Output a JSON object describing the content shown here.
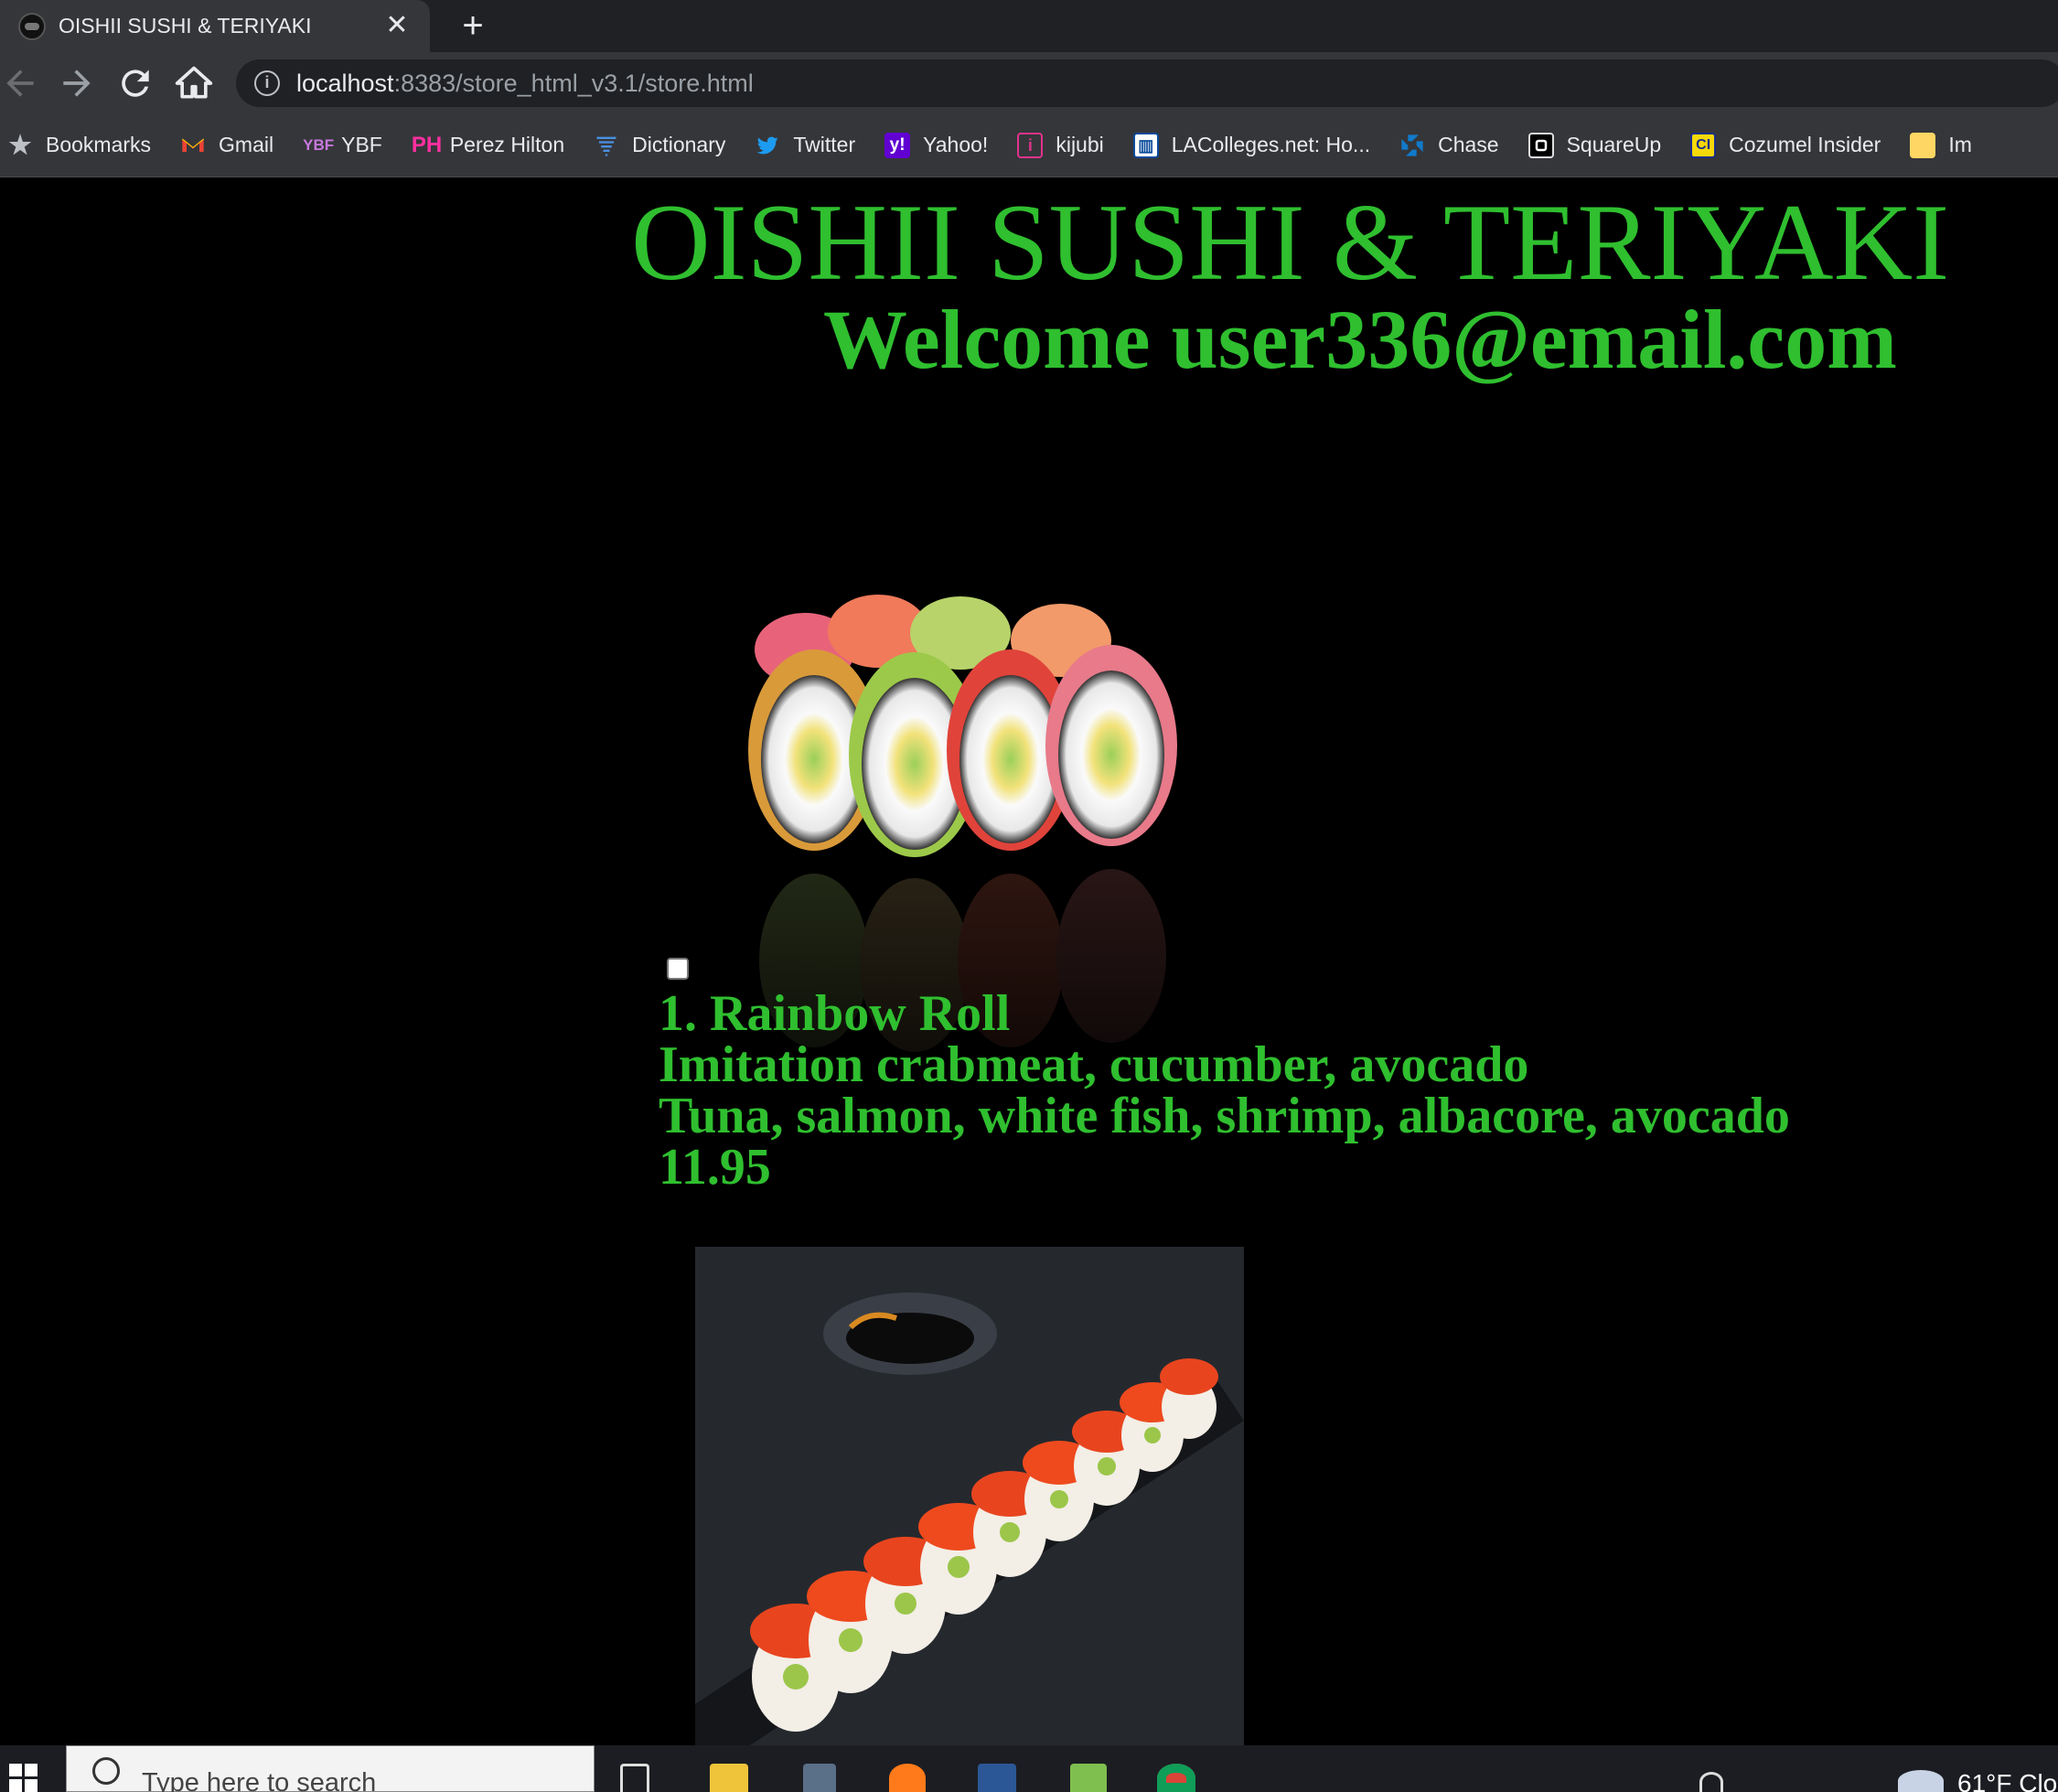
{
  "browser": {
    "tab_title": "OISHII SUSHI & TERIYAKI",
    "tab_close": "✕",
    "new_tab": "+",
    "url_host": "localhost",
    "url_path": ":8383/store_html_v3.1/store.html"
  },
  "bookmarks": [
    {
      "label": "Bookmarks",
      "icon": "star-icon"
    },
    {
      "label": "Gmail",
      "icon": "gmail-icon"
    },
    {
      "label": "YBF",
      "icon": "ybf-icon"
    },
    {
      "label": "Perez Hilton",
      "icon": "perez-hilton-icon"
    },
    {
      "label": "Dictionary",
      "icon": "dictionary-icon"
    },
    {
      "label": "Twitter",
      "icon": "twitter-icon"
    },
    {
      "label": "Yahoo!",
      "icon": "yahoo-icon"
    },
    {
      "label": "kijubi",
      "icon": "kijubi-icon"
    },
    {
      "label": "LAColleges.net: Ho...",
      "icon": "lacolleges-icon"
    },
    {
      "label": "Chase",
      "icon": "chase-icon"
    },
    {
      "label": "SquareUp",
      "icon": "squareup-icon"
    },
    {
      "label": "Cozumel Insider",
      "icon": "cozumel-icon"
    },
    {
      "label": "Im",
      "icon": "folder-icon"
    }
  ],
  "page": {
    "title": "OISHII SUSHI & TERIYAKI",
    "welcome": "Welcome user336@email.com",
    "items": [
      {
        "name": "1. Rainbow Roll",
        "inside": "Imitation crabmeat, cucumber, avocado",
        "topping": "Tuna, salmon, white fish, shrimp, albacore, avocado",
        "price": "11.95",
        "checked": false
      }
    ]
  },
  "taskbar": {
    "search_placeholder": "Type here to search",
    "weather": "61°F  Clo"
  },
  "colors": {
    "accent_green": "#2fbf2f",
    "page_bg": "#000000",
    "chrome_bg": "#35363a"
  }
}
